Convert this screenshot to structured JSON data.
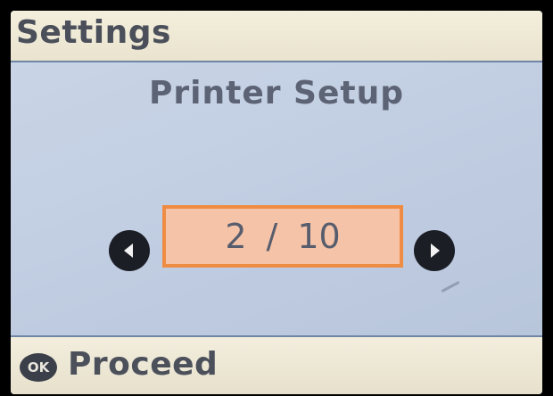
{
  "header": {
    "title": "Settings"
  },
  "main": {
    "label": "Printer Setup",
    "pager": {
      "current": "2",
      "separator": "/",
      "total": "10",
      "prev_icon": "left-arrow-icon",
      "next_icon": "right-arrow-icon"
    }
  },
  "footer": {
    "ok_badge": "OK",
    "action_label": "Proceed"
  },
  "colors": {
    "screen_bg": "#c8d3e3",
    "header_bg": "#f4efdc",
    "accent_border": "#ef8c43",
    "selection_fill": "#f5c3a8",
    "text": "#5c6374"
  }
}
